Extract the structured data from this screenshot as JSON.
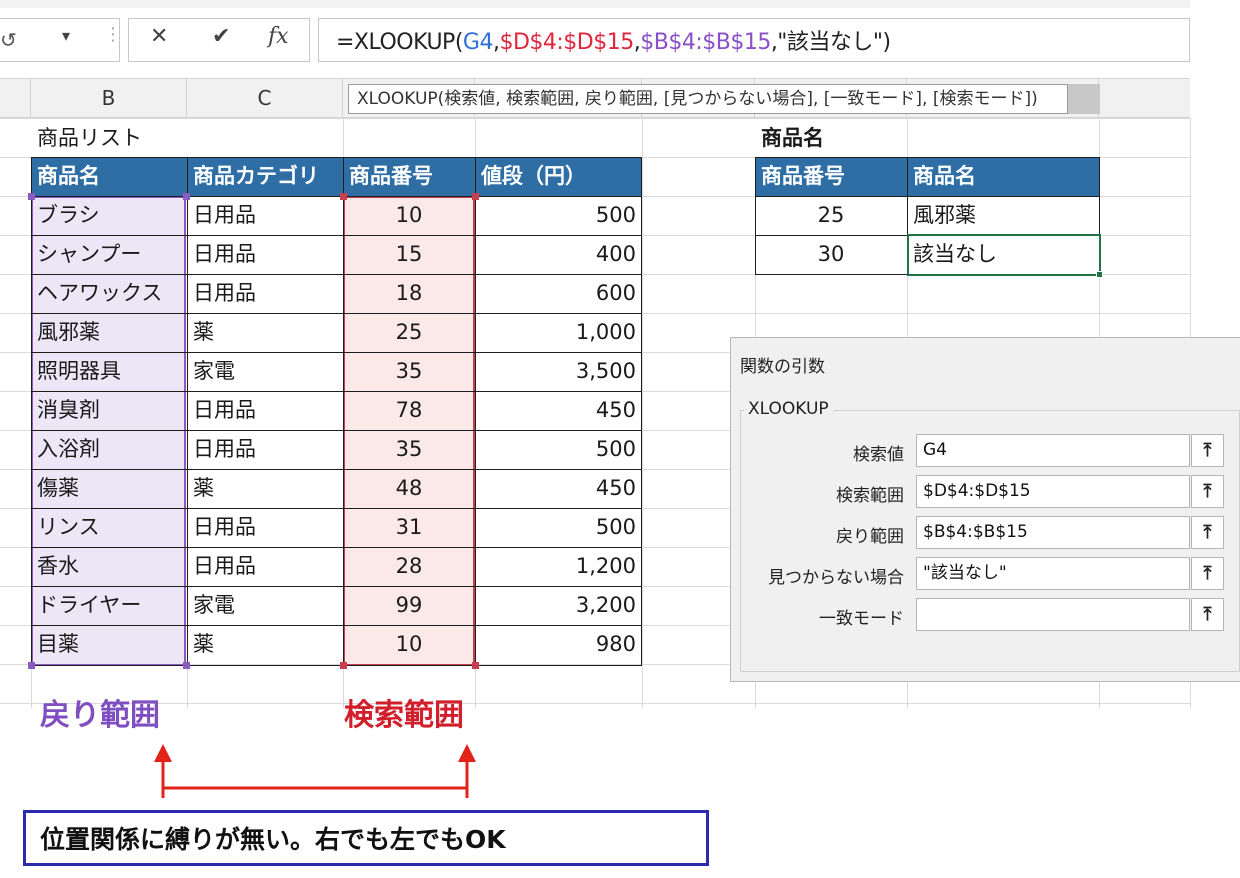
{
  "formula_bar": {
    "namebox_text": "↺",
    "cancel_icon": "✕",
    "enter_icon": "✔",
    "fx_label": "fx",
    "formula_tokens": [
      {
        "text": "=XLOOKUP(",
        "color": "default"
      },
      {
        "text": "G4",
        "color": "g4"
      },
      {
        "text": ",",
        "color": "default"
      },
      {
        "text": "$D$4:$D$15",
        "color": "d"
      },
      {
        "text": ",",
        "color": "default"
      },
      {
        "text": "$B$4:$B$15",
        "color": "b"
      },
      {
        "text": ",\"該当なし\")",
        "color": "default"
      }
    ]
  },
  "columns": {
    "b": "B",
    "c": "C"
  },
  "tooltip": "XLOOKUP(検索値, 検索範囲, 戻り範囲, [見つからない場合], [一致モード], [検索モード])",
  "left_table": {
    "title": "商品リスト",
    "headers": [
      "商品名",
      "商品カテゴリ",
      "商品番号",
      "値段（円）"
    ],
    "rows": [
      [
        "ブラシ",
        "日用品",
        "10",
        "500"
      ],
      [
        "シャンプー",
        "日用品",
        "15",
        "400"
      ],
      [
        "ヘアワックス",
        "日用品",
        "18",
        "600"
      ],
      [
        "風邪薬",
        "薬",
        "25",
        "1,000"
      ],
      [
        "照明器具",
        "家電",
        "35",
        "3,500"
      ],
      [
        "消臭剤",
        "日用品",
        "78",
        "450"
      ],
      [
        "入浴剤",
        "日用品",
        "35",
        "500"
      ],
      [
        "傷薬",
        "薬",
        "48",
        "450"
      ],
      [
        "リンス",
        "日用品",
        "31",
        "500"
      ],
      [
        "香水",
        "日用品",
        "28",
        "1,200"
      ],
      [
        "ドライヤー",
        "家電",
        "99",
        "3,200"
      ],
      [
        "目薬",
        "薬",
        "10",
        "980"
      ]
    ]
  },
  "right_table": {
    "title": "商品名",
    "headers": [
      "商品番号",
      "商品名"
    ],
    "rows": [
      [
        "25",
        "風邪薬"
      ],
      [
        "30",
        "該当なし"
      ]
    ]
  },
  "dialog": {
    "title": "関数の引数",
    "group": "XLOOKUP",
    "args": [
      {
        "label": "検索値",
        "value": "G4"
      },
      {
        "label": "検索範囲",
        "value": "$D$4:$D$15"
      },
      {
        "label": "戻り範囲",
        "value": "$B$4:$B$15"
      },
      {
        "label": "見つからない場合",
        "value": "\"該当なし\""
      },
      {
        "label": "一致モード",
        "value": ""
      }
    ],
    "collapse_icon": "⤒"
  },
  "annotations": {
    "return_range": "戻り範囲",
    "search_range": "検索範囲",
    "note": "位置関係に縛りが無い。右でも左でもOK"
  },
  "colors": {
    "header_fill": "#2e6ea5",
    "return_range": "#7f4fc2",
    "search_range": "#d11f2c",
    "active_cell": "#217346",
    "note_border": "#2b2bb0"
  }
}
